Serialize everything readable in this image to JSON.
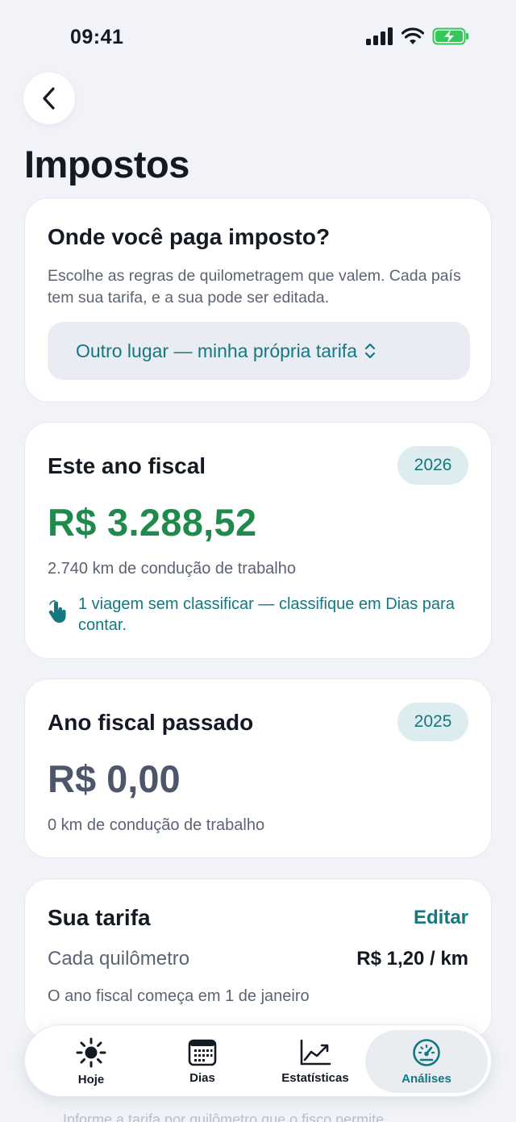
{
  "status": {
    "time": "09:41"
  },
  "title": "Impostos",
  "tax_location": {
    "title": "Onde você paga imposto?",
    "description": "Escolhe as regras de quilometragem que valem. Cada país tem sua tarifa, e a sua pode ser editada.",
    "selected": "Outro lugar — minha própria tarifa"
  },
  "this_year": {
    "title": "Este ano fiscal",
    "year": "2026",
    "amount": "R$ 3.288,52",
    "km": "2.740 km de condução de trabalho",
    "hint": "1 viagem sem classificar — classifique em Dias para contar."
  },
  "last_year": {
    "title": "Ano fiscal passado",
    "year": "2025",
    "amount": "R$ 0,00",
    "km": "0 km de condução de trabalho"
  },
  "rate": {
    "title": "Sua tarifa",
    "edit": "Editar",
    "label": "Cada quilômetro",
    "value": "R$ 1,20 / km",
    "fiscal_start": "O ano fiscal começa em 1 de janeiro"
  },
  "below_text": "Informe a tarifa por quilômetro que o fisco permite",
  "tabs": [
    {
      "label": "Hoje",
      "icon": "sun-icon"
    },
    {
      "label": "Dias",
      "icon": "calendar-icon"
    },
    {
      "label": "Estatísticas",
      "icon": "chart-line-icon"
    },
    {
      "label": "Análises",
      "icon": "gauge-icon"
    }
  ],
  "colors": {
    "accent": "#137880",
    "positive": "#1f8a4c",
    "background": "#f1f3f8",
    "battery": "#34c759"
  }
}
